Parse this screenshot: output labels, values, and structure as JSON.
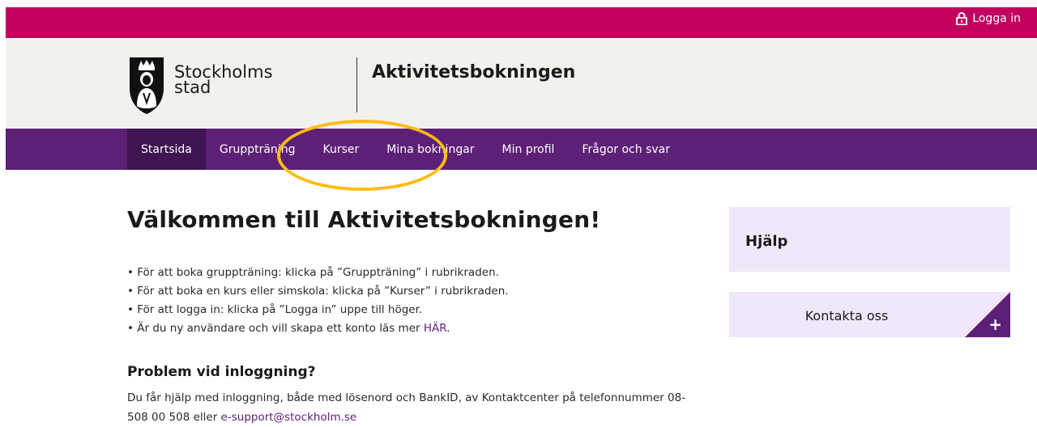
{
  "topbar": {
    "login_label": "Logga in",
    "icon": "lock-icon",
    "color": "#c2005e"
  },
  "header": {
    "logo_line1": "Stockholms",
    "logo_line2": "stad",
    "site_title": "Aktivitetsbokningen",
    "background": "#f3f1ee"
  },
  "nav": {
    "color": "#5d2077",
    "items": [
      {
        "label": "Startsida",
        "active": true
      },
      {
        "label": "Gruppträning"
      },
      {
        "label": "Kurser"
      },
      {
        "label": "Mina bokningar"
      },
      {
        "label": "Min profil"
      },
      {
        "label": "Frågor och svar"
      }
    ]
  },
  "main": {
    "title": "Välkommen till Aktivitetsbokningen!",
    "bullets": [
      "För att boka gruppträning: klicka på ”Gruppträning” i rubrikraden.",
      "För att boka en kurs eller simskola: klicka på ”Kurser” i rubrikraden.",
      "För att logga in: klicka på ”Logga in” uppe till höger."
    ],
    "bullet4_prefix": "Är du ny användare och vill skapa ett konto läs mer ",
    "bullet4_link": "HÄR",
    "bullet4_suffix": ".",
    "problem_heading": "Problem vid inloggning?",
    "problem_text": "Du får hjälp med inloggning, både med lösenord och BankID, av Kontaktcenter på telefonnummer 08-508 00 508 eller ",
    "problem_email": "e-support@stockholm.se"
  },
  "sidebar": {
    "help_title": "Hjälp",
    "contact_label": "Kontakta oss",
    "contact_plus": "+"
  }
}
